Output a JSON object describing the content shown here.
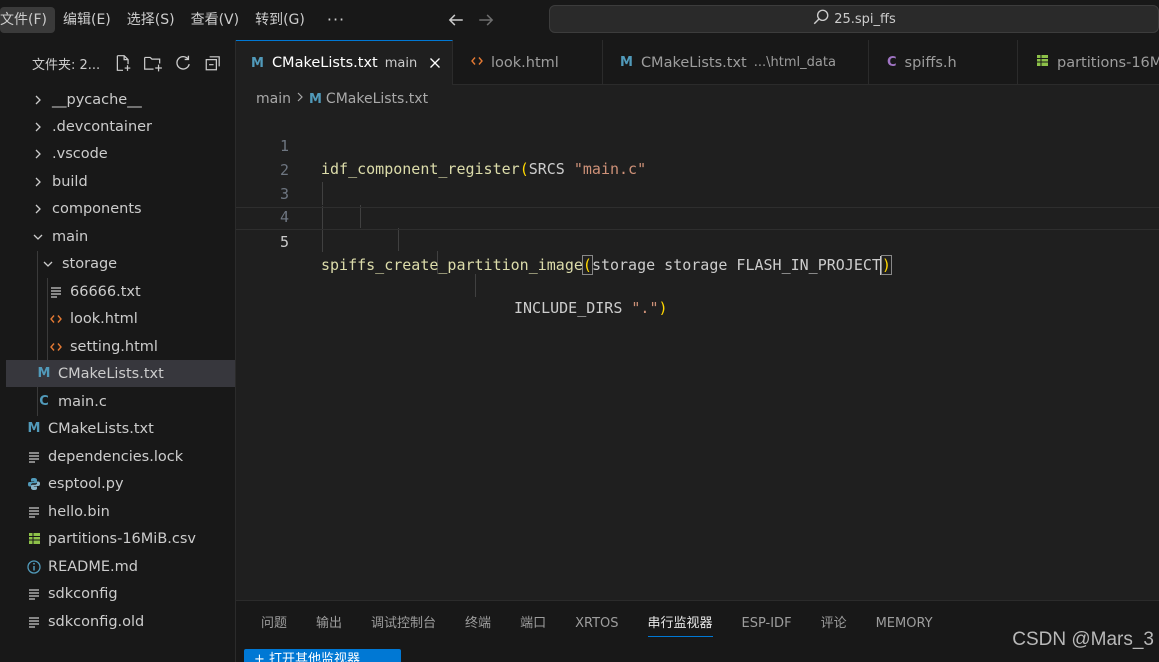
{
  "menu": {
    "file": "文件(F)",
    "edit": "编辑(E)",
    "select": "选择(S)",
    "view": "查看(V)",
    "goto": "转到(G)",
    "more": "···"
  },
  "search": {
    "text": "25.spi_ffs"
  },
  "explorer": {
    "title": "文件夹: 2...",
    "items": [
      {
        "label": "__pycache__"
      },
      {
        "label": ".devcontainer"
      },
      {
        "label": ".vscode"
      },
      {
        "label": "build"
      },
      {
        "label": "components"
      },
      {
        "label": "main"
      },
      {
        "label": "storage"
      },
      {
        "label": "66666.txt"
      },
      {
        "label": "look.html"
      },
      {
        "label": "setting.html"
      },
      {
        "label": "CMakeLists.txt"
      },
      {
        "label": "main.c"
      },
      {
        "label": "CMakeLists.txt"
      },
      {
        "label": "dependencies.lock"
      },
      {
        "label": "esptool.py"
      },
      {
        "label": "hello.bin"
      },
      {
        "label": "partitions-16MiB.csv"
      },
      {
        "label": "README.md"
      },
      {
        "label": "sdkconfig"
      },
      {
        "label": "sdkconfig.old"
      }
    ]
  },
  "tabs": [
    {
      "label": "CMakeLists.txt",
      "desc": "main",
      "icon": "M"
    },
    {
      "label": "look.html",
      "desc": "",
      "icon": "<>"
    },
    {
      "label": "CMakeLists.txt",
      "desc": "...\\html_data",
      "icon": "M"
    },
    {
      "label": "spiffs.h",
      "desc": "",
      "icon": "C"
    },
    {
      "label": "partitions-16M",
      "desc": "",
      "icon": "grid"
    }
  ],
  "breadcrumb": {
    "folder": "main",
    "file": "CMakeLists.txt"
  },
  "code": {
    "lines": [
      {
        "num": "1",
        "parts": [
          "idf_component_register",
          "(",
          "SRCS ",
          "\"main.c\""
        ]
      },
      {
        "num": "2",
        "parts": [
          "INCLUDE_DIRS ",
          "\".\"",
          ")"
        ]
      },
      {
        "num": "3",
        "parts": []
      },
      {
        "num": "4",
        "parts": []
      },
      {
        "num": "5",
        "parts": [
          "spiffs_create_partition_image",
          "(",
          "storage storage FLASH_IN_PROJECT",
          ")"
        ]
      }
    ]
  },
  "panel": {
    "tabs": [
      "问题",
      "输出",
      "调试控制台",
      "终端",
      "端口",
      "XRTOS",
      "串行监视器",
      "ESP-IDF",
      "评论",
      "MEMORY"
    ],
    "button": "+ 打开其他监视器"
  },
  "watermark": "CSDN @Mars_3",
  "colors": {
    "accent": "#0078d4",
    "cmake_icon": "#519aba",
    "html_icon": "#e37933",
    "c_icon": "#a074c4",
    "csv_icon": "#8dc149",
    "python_icon": "#519aba"
  }
}
